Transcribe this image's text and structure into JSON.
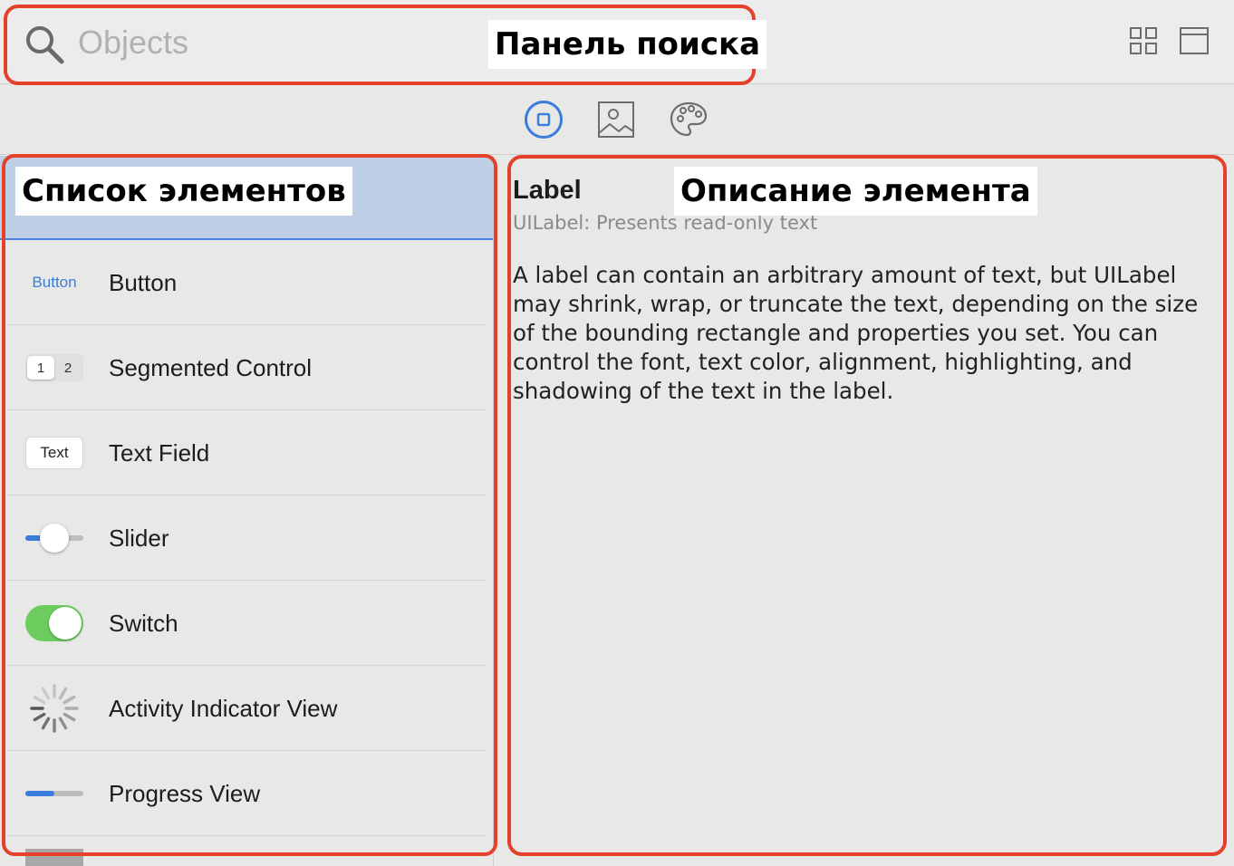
{
  "search": {
    "placeholder": "Objects"
  },
  "header_buttons": [
    {
      "name": "grid-view-icon"
    },
    {
      "name": "window-layout-icon"
    }
  ],
  "library_tabs": [
    {
      "name": "objects-tab",
      "icon": "square-in-circle-icon",
      "selected": true
    },
    {
      "name": "media-tab",
      "icon": "image-icon",
      "selected": false
    },
    {
      "name": "colors-tab",
      "icon": "palette-icon",
      "selected": false
    }
  ],
  "object_list": {
    "items": [
      {
        "label": "Button",
        "preview_text": "Button"
      },
      {
        "label": "Segmented Control",
        "segments": [
          "1",
          "2"
        ]
      },
      {
        "label": "Text Field",
        "preview_text": "Text"
      },
      {
        "label": "Slider",
        "value": 0.5
      },
      {
        "label": "Switch",
        "on": true
      },
      {
        "label": "Activity Indicator View"
      },
      {
        "label": "Progress View",
        "value": 0.5
      }
    ]
  },
  "detail": {
    "title": "Label",
    "subtitle": "UILabel: Presents read-only text",
    "description": "A label can contain an arbitrary amount of text, but UILabel may shrink, wrap, or truncate the text, depending on the size of the bounding rectangle and properties you set. You can control the font, text color, alignment, highlighting, and shadowing of the text in the label."
  },
  "annotations": {
    "search_panel": "Панель поиска",
    "element_list": "Список элементов",
    "element_description": "Описание элемента"
  },
  "colors": {
    "accent": "#3b7ddd",
    "callout_red": "#e4402a",
    "switch_on": "#6ccd5e",
    "selection_bg": "#bfcfe6"
  }
}
